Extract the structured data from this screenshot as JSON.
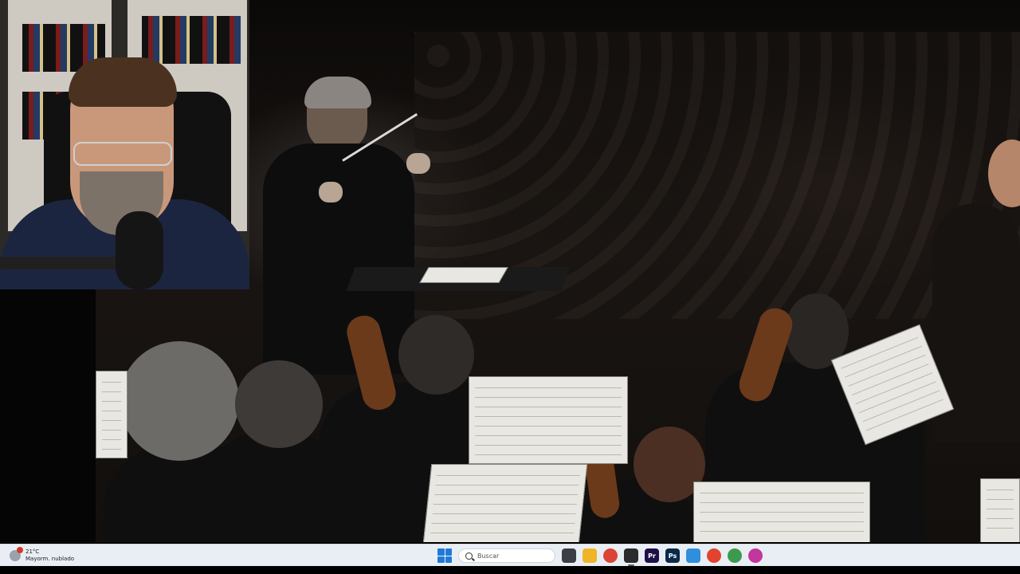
{
  "taskbar": {
    "weather": {
      "temperature": "21°C",
      "condition": "Mayorm. nublado",
      "icon": "weather-cloud-icon",
      "alert_color": "#d23a2a"
    },
    "search_placeholder": "Buscar",
    "start_icon": "windows-start-icon",
    "apps": [
      {
        "name": "task-view-icon",
        "label": "",
        "color": "#3b3f45"
      },
      {
        "name": "file-explorer-icon",
        "label": "",
        "color": "#f0b429"
      },
      {
        "name": "chrome-icon",
        "label": "",
        "color": "#db4437"
      },
      {
        "name": "obs-icon",
        "label": "",
        "color": "#2b2b2b"
      },
      {
        "name": "premiere-pro-icon",
        "label": "Pr",
        "color": "#1f1147"
      },
      {
        "name": "photoshop-icon",
        "label": "Ps",
        "color": "#0b2a4a"
      },
      {
        "name": "photos-icon",
        "label": "",
        "color": "#2f8fdc"
      },
      {
        "name": "chrome-profile-icon-1",
        "label": "",
        "color": "#e0442f"
      },
      {
        "name": "chrome-profile-icon-2",
        "label": "",
        "color": "#3c9a4f"
      },
      {
        "name": "chrome-profile-icon-3",
        "label": "",
        "color": "#c2369d"
      }
    ]
  }
}
